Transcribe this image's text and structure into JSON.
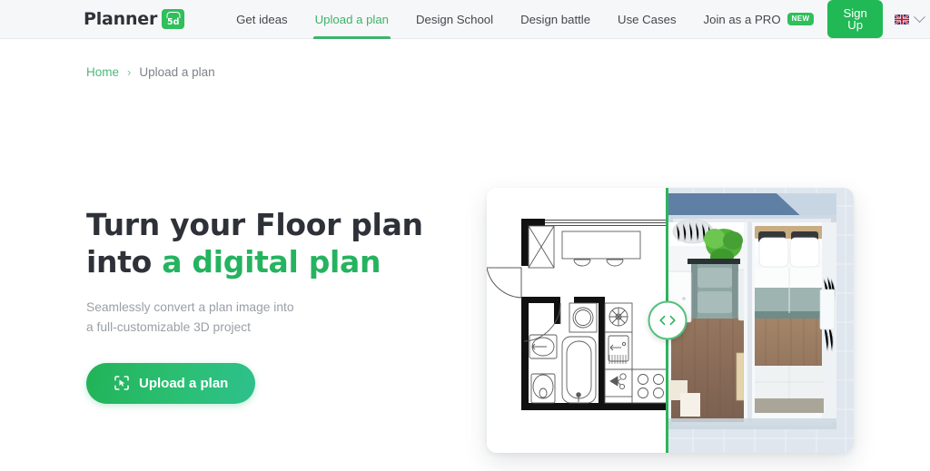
{
  "nav": {
    "logo": {
      "text": "Planner",
      "badge_text": "5d",
      "icon": "house-roof-icon"
    },
    "links": [
      {
        "label": "Get ideas",
        "active": false,
        "badge": ""
      },
      {
        "label": "Upload a plan",
        "active": true,
        "badge": ""
      },
      {
        "label": "Design School",
        "active": false,
        "badge": ""
      },
      {
        "label": "Design battle",
        "active": false,
        "badge": ""
      },
      {
        "label": "Use Cases",
        "active": false,
        "badge": ""
      },
      {
        "label": "Join as a PRO",
        "active": false,
        "badge": "NEW"
      }
    ],
    "signup_label": "Sign Up",
    "language": {
      "flag": "uk-flag-icon",
      "chevron": "chevron-down-icon"
    }
  },
  "breadcrumb": {
    "home": "Home",
    "separator": "›",
    "current": "Upload a plan"
  },
  "hero": {
    "title_line1": "Turn your Floor plan",
    "title_line2_plain": "into ",
    "title_line2_accent": "a digital plan",
    "subtitle_line1": "Seamlessly convert a plan image into",
    "subtitle_line2": "a full-customizable 3D project",
    "cta_label": "Upload a plan",
    "cta_icon": "scan-upload-icon"
  },
  "comparison": {
    "left_pane": "2d-floor-plan",
    "right_pane": "3d-rendered-plan",
    "handle_icon": "left-right-arrows-icon"
  },
  "colors": {
    "brand_green": "#2fbf5c",
    "accent_green": "#25b35f",
    "nav_bg": "#f6f7f8",
    "text_dark": "#2e3238",
    "text_muted": "#9a9fa6",
    "divider_green": "#2eb45e"
  }
}
